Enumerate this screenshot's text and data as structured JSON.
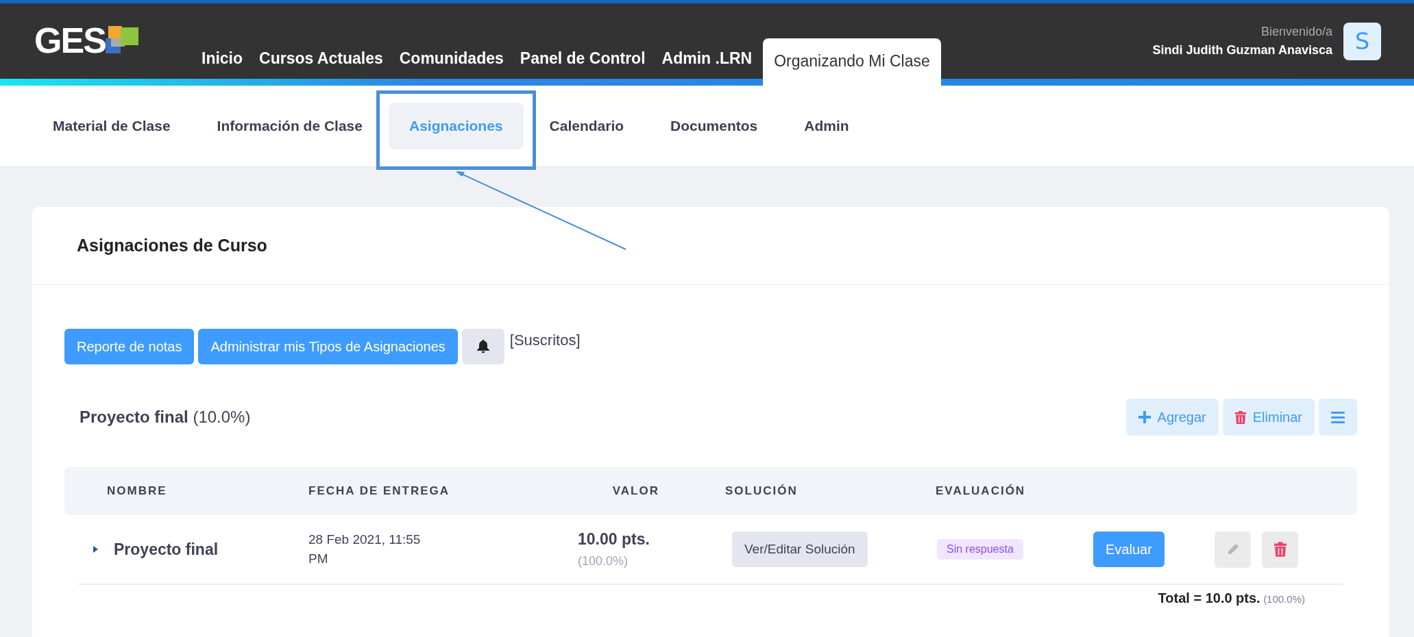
{
  "logo": {
    "text": "GES"
  },
  "nav": {
    "items": [
      {
        "label": "Inicio",
        "selected": false
      },
      {
        "label": "Cursos Actuales",
        "selected": false
      },
      {
        "label": "Comunidades",
        "selected": false
      },
      {
        "label": "Panel de Control",
        "selected": false
      },
      {
        "label": "Admin .LRN",
        "selected": false
      },
      {
        "label": "Organizando Mi Clase",
        "selected": true
      }
    ]
  },
  "user": {
    "greeting": "Bienvenido/a",
    "name": "Sindi Judith Guzman Anavisca",
    "avatar": "S"
  },
  "subnav": {
    "items": [
      {
        "label": "Material de Clase",
        "selected": false
      },
      {
        "label": "Información de Clase",
        "selected": false
      },
      {
        "label": "Asignaciones",
        "selected": true
      },
      {
        "label": "Calendario",
        "selected": false
      },
      {
        "label": "Documentos",
        "selected": false
      },
      {
        "label": "Admin",
        "selected": false
      }
    ]
  },
  "card": {
    "title": "Asignaciones de Curso"
  },
  "toolbar": {
    "buttons": [
      {
        "label": "Reporte de notas"
      },
      {
        "label": "Administrar mis Tipos de Asignaciones"
      }
    ],
    "subscription": "[Suscritos]"
  },
  "section": {
    "title": "Proyecto final",
    "weight": "(10.0%)",
    "actions": [
      {
        "kind": "add",
        "label": "Agregar"
      },
      {
        "kind": "delete",
        "label": "Eliminar"
      },
      {
        "kind": "menu"
      }
    ]
  },
  "table": {
    "columns": [
      "NOMBRE",
      "FECHA DE ENTREGA",
      "VALOR",
      "SOLUCIÓN",
      "EVALUACIÓN"
    ],
    "rows": [
      {
        "name": "Proyecto final",
        "expanded": false,
        "due": "28 Feb 2021, 11:55 PM",
        "points": "10.00 pts.",
        "percent": "(100.0%)",
        "solution_button": "Ver/Editar Solución",
        "status": "Sin respuesta",
        "evaluate_button": "Evaluar"
      }
    ]
  },
  "total": {
    "label": "Total = 10.0 pts.",
    "percent": "(100.0%)"
  }
}
